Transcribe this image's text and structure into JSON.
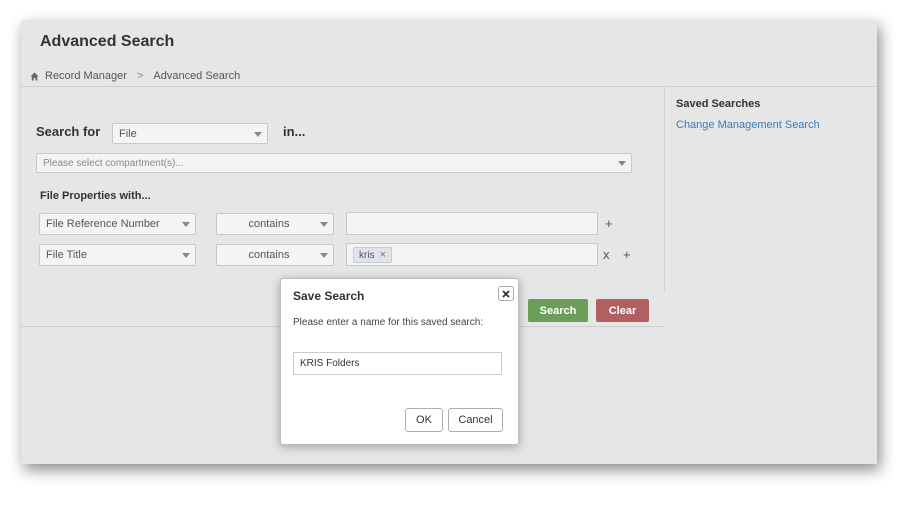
{
  "page": {
    "title": "Advanced Search"
  },
  "breadcrumb": {
    "items": [
      "Record Manager",
      "Advanced Search"
    ],
    "separator": ">"
  },
  "search": {
    "search_for_label": "Search for",
    "type_value": "File",
    "in_label": "in...",
    "compartment_placeholder": "Please select compartment(s)..."
  },
  "file_properties": {
    "label": "File Properties with...",
    "rows": [
      {
        "property": "File Reference Number",
        "operator": "contains",
        "value": "",
        "add": "+"
      },
      {
        "property": "File Title",
        "operator": "contains",
        "tags": [
          "kris"
        ],
        "tag_remove": "×",
        "remove": "x",
        "add": "+"
      }
    ]
  },
  "buttons": {
    "search": "Search",
    "clear": "Clear"
  },
  "saved_searches": {
    "title": "Saved Searches",
    "items": [
      "Change Management Search"
    ]
  },
  "modal": {
    "title": "Save Search",
    "prompt": "Please enter a name for this saved search:",
    "name_value": "KRIS Folders",
    "ok": "OK",
    "cancel": "Cancel"
  },
  "colors": {
    "search_button": "#6a9e5a",
    "clear_button": "#b06060",
    "link": "#3a7bbd"
  }
}
